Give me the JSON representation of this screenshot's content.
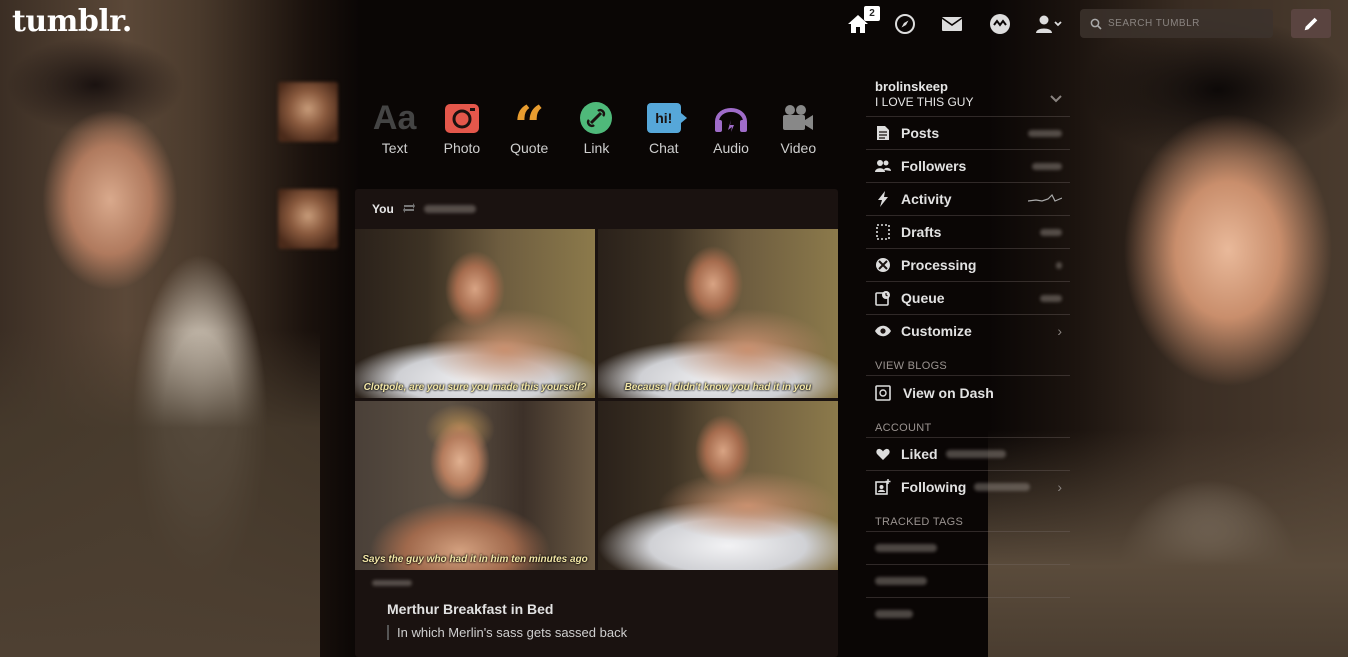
{
  "header": {
    "logo": "tumblr.",
    "home_badge": "2",
    "search_placeholder": "SEARCH TUMBLR",
    "icons": [
      "home-icon",
      "explore-compass-icon",
      "inbox-mail-icon",
      "activity-icon",
      "account-icon",
      "compose-pencil-icon"
    ]
  },
  "post_types": [
    {
      "label": "Text",
      "icon": "text-aa-icon",
      "color": "#444444"
    },
    {
      "label": "Photo",
      "icon": "camera-icon",
      "color": "#e4574b"
    },
    {
      "label": "Quote",
      "icon": "quote-icon",
      "color": "#e89c2f"
    },
    {
      "label": "Link",
      "icon": "link-icon",
      "color": "#4fb97a"
    },
    {
      "label": "Chat",
      "icon": "chat-icon",
      "color": "#56a7d9",
      "glyph": "hi!"
    },
    {
      "label": "Audio",
      "icon": "headphones-icon",
      "color": "#9f6cc9"
    },
    {
      "label": "Video",
      "icon": "video-camera-icon",
      "color": "#888888"
    }
  ],
  "post": {
    "author": "You",
    "captions": [
      "Clotpole, are you sure you made this yourself?",
      "Because I didn't know you had it in you",
      "Says the guy who had it in him ten minutes ago",
      ""
    ],
    "title": "Merthur Breakfast in Bed",
    "quote": "In which Merlin's sass gets sassed back"
  },
  "sidebar": {
    "blog_name": "brolinskeep",
    "blog_title": "I LOVE THIS GUY",
    "items": [
      {
        "label": "Posts",
        "icon": "posts-icon"
      },
      {
        "label": "Followers",
        "icon": "followers-icon"
      },
      {
        "label": "Activity",
        "icon": "activity-bolt-icon"
      },
      {
        "label": "Drafts",
        "icon": "drafts-icon"
      },
      {
        "label": "Processing",
        "icon": "processing-icon"
      },
      {
        "label": "Queue",
        "icon": "queue-icon"
      },
      {
        "label": "Customize",
        "icon": "eye-icon"
      }
    ],
    "view_blogs_heading": "VIEW BLOGS",
    "view_on_dash": "View on Dash",
    "account_heading": "ACCOUNT",
    "liked": "Liked",
    "following": "Following",
    "tracked_tags_heading": "TRACKED TAGS"
  }
}
